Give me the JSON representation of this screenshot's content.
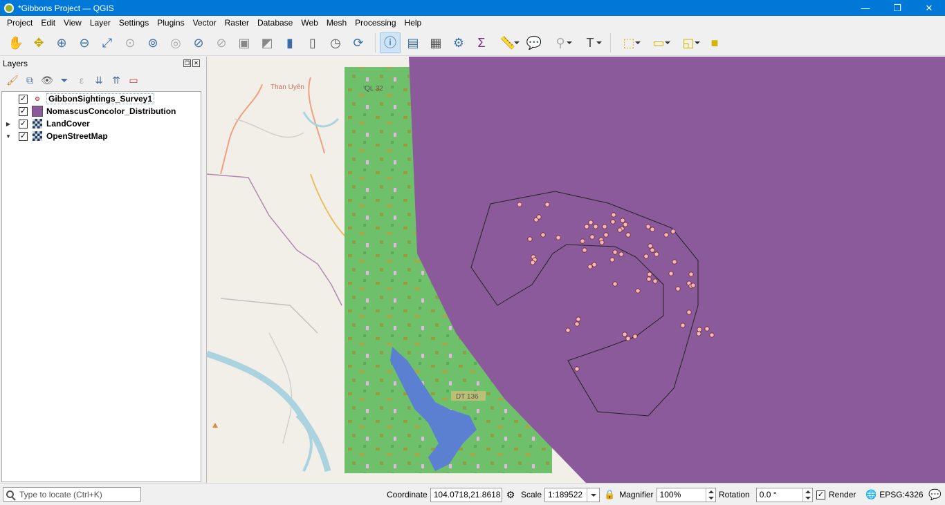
{
  "window": {
    "title": "*Gibbons Project — QGIS",
    "minimize": "—",
    "restore": "❐",
    "close": "✕"
  },
  "menu": [
    "Project",
    "Edit",
    "View",
    "Layer",
    "Settings",
    "Plugins",
    "Vector",
    "Raster",
    "Database",
    "Web",
    "Mesh",
    "Processing",
    "Help"
  ],
  "layers_panel": {
    "title": "Layers",
    "layers": [
      {
        "name": "GibbonSightings_Survey1",
        "checked": "✓",
        "symbol": "point",
        "expandable": false,
        "selected": true
      },
      {
        "name": "NomascusConcolor_Distribution",
        "checked": "✓",
        "symbol": "polygon",
        "expandable": false
      },
      {
        "name": "LandCover",
        "checked": "✓",
        "symbol": "raster",
        "expander": "▶"
      },
      {
        "name": "OpenStreetMap",
        "checked": "✓",
        "symbol": "raster",
        "expander": "▼"
      }
    ]
  },
  "map": {
    "labels": {
      "town": "Than Uyên",
      "road1": "QL 32",
      "road2": "DT 136"
    },
    "colors": {
      "distribution": "#8b5a9a",
      "landcover_green": "#6fc06a",
      "water": "#5b7fd1",
      "osm_bg": "#f2efe9",
      "sighting": "#f5b7b9"
    }
  },
  "statusbar": {
    "locate_placeholder": "Type to locate (Ctrl+K)",
    "coordinate_label": "Coordinate",
    "coordinate_value": "104.0718,21.8618",
    "scale_label": "Scale",
    "scale_value": "1:189522",
    "magnifier_label": "Magnifier",
    "magnifier_value": "100%",
    "rotation_label": "Rotation",
    "rotation_value": "0.0 °",
    "render_label": "Render",
    "render_checked": "✓",
    "crs": "EPSG:4326"
  }
}
